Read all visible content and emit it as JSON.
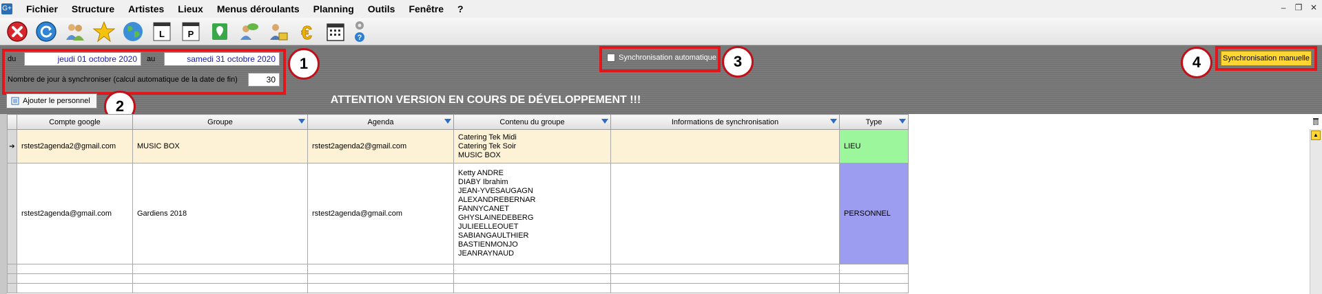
{
  "menu": [
    "Fichier",
    "Structure",
    "Artistes",
    "Lieux",
    "Menus déroulants",
    "Planning",
    "Outils",
    "Fenêtre",
    "?"
  ],
  "app_icon_text": "G+",
  "toolbar_icons": [
    "close-icon",
    "refresh-icon",
    "people-icon",
    "star-icon",
    "globe-icon",
    "l-document-icon",
    "p-document-icon",
    "map-pin-icon",
    "users-chat-icon",
    "person-money-icon",
    "euro-icon",
    "calendar-icon",
    "gear-help-icon"
  ],
  "filter": {
    "from_label": "du",
    "from_value": "jeudi 01 octobre 2020",
    "to_label": "au",
    "to_value": "samedi 31 octobre 2020",
    "days_label": "Nombre de jour à synchroniser (calcul automatique de la date de fin)",
    "days_value": "30",
    "auto_sync_label": "Synchronisation automatique",
    "auto_sync_checked": false,
    "manual_sync_label": "Synchronisation manuelle",
    "add_staff_label": "Ajouter le personnel",
    "attention": "ATTENTION VERSION EN COURS DE DÉVELOPPEMENT !!!"
  },
  "badges": [
    "1",
    "2",
    "3",
    "4"
  ],
  "table": {
    "columns": [
      "Compte google",
      "Groupe",
      "Agenda",
      "Contenu du groupe",
      "Informations de synchronisation",
      "Type"
    ],
    "rows": [
      {
        "compte": "rstest2agenda2@gmail.com",
        "groupe": "MUSIC BOX",
        "agenda": "rstest2agenda2@gmail.com",
        "contenu": "Catering Tek Midi\nCatering Tek Soir\nMUSIC BOX",
        "infos": "",
        "type": "LIEU"
      },
      {
        "compte": "rstest2agenda@gmail.com",
        "groupe": "Gardiens 2018",
        "agenda": "rstest2agenda@gmail.com",
        "contenu": "Ketty ANDRE\nDIABY Ibrahim\nJEAN-YVESAUGAGN\nALEXANDREBERNAR\nFANNYCANET\nGHYSLAINEDEBERG\nJULIEELLEOUET\nSABIANGAULTHIER\nBASTIENMONJO\nJEANRAYNAUD",
        "infos": "",
        "type": "PERSONNEL"
      }
    ]
  },
  "colors": {
    "accent_red": "#e0161b",
    "button_yellow": "#ffd633",
    "type_lieu": "#9cf79c",
    "type_personnel": "#9c9cf1",
    "selected_row": "#fdf1d6"
  }
}
